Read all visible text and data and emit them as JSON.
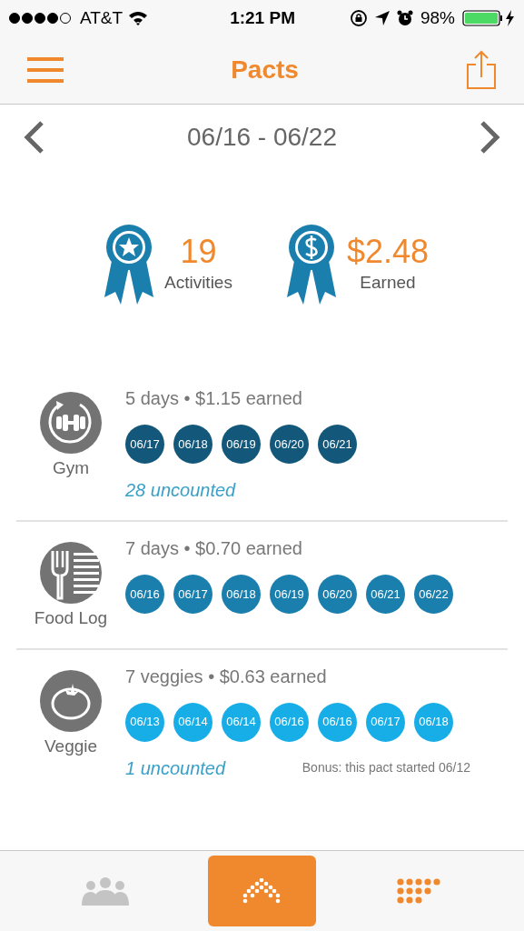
{
  "status_bar": {
    "carrier": "AT&T",
    "time": "1:21 PM",
    "battery": "98%"
  },
  "nav": {
    "title": "Pacts"
  },
  "week": {
    "range": "06/16 - 06/22"
  },
  "stats": [
    {
      "kind": "star",
      "value": "19",
      "label": "Activities"
    },
    {
      "kind": "dollar",
      "value": "$2.48",
      "label": "Earned"
    }
  ],
  "pacts": [
    {
      "kind": "gym",
      "name": "Gym",
      "summary": "5 days • $1.15 earned",
      "color": "#13587a",
      "dates": [
        "06/17",
        "06/18",
        "06/19",
        "06/20",
        "06/21"
      ],
      "uncounted": "28 uncounted"
    },
    {
      "kind": "food",
      "name": "Food Log",
      "summary": "7 days • $0.70 earned",
      "color": "#1b7fad",
      "dates": [
        "06/16",
        "06/17",
        "06/18",
        "06/19",
        "06/20",
        "06/21",
        "06/22"
      ]
    },
    {
      "kind": "veggie",
      "name": "Veggie",
      "summary": "7 veggies • $0.63 earned",
      "color": "#17aee8",
      "dates": [
        "06/13",
        "06/14",
        "06/14",
        "06/16",
        "06/16",
        "06/17",
        "06/18"
      ],
      "uncounted": "1 uncounted",
      "note": "Bonus: this pact started 06/12"
    }
  ],
  "tabs": [
    {
      "kind": "people",
      "selected": false
    },
    {
      "kind": "pacts",
      "selected": true
    },
    {
      "kind": "grid",
      "selected": false
    }
  ]
}
